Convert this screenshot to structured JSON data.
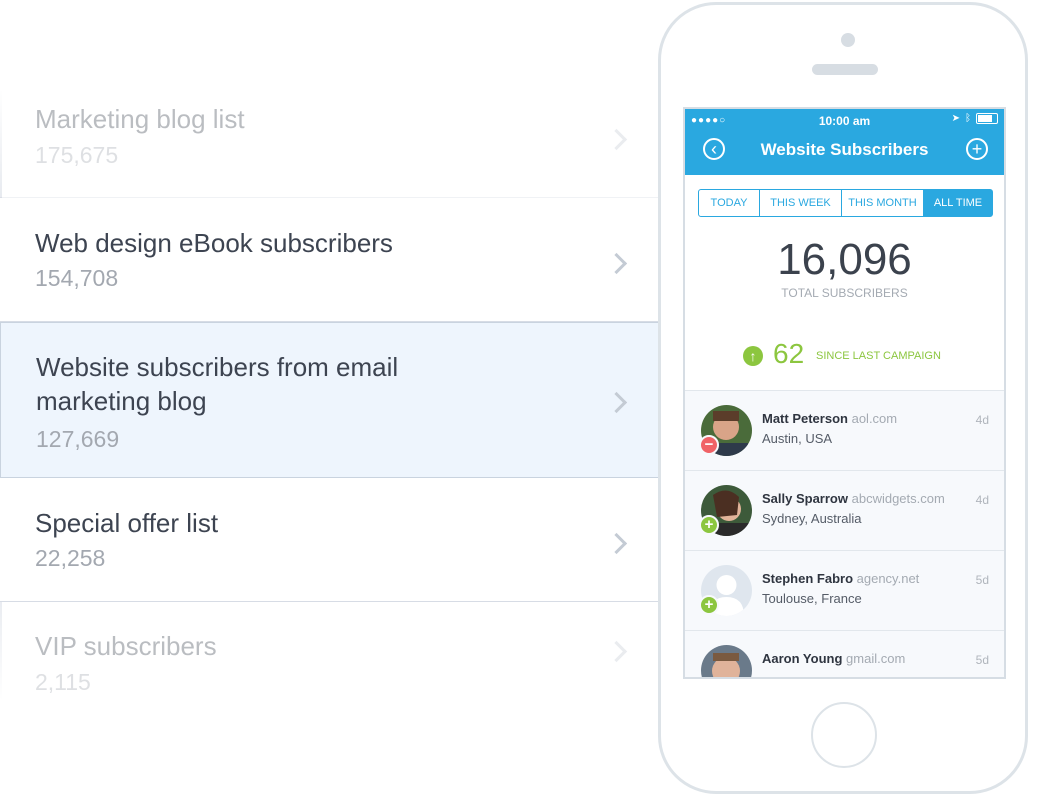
{
  "lists": [
    {
      "title": "Marketing blog list",
      "count": "175,675"
    },
    {
      "title": "Web design eBook subscribers",
      "count": "154,708"
    },
    {
      "title": "Website subscribers from email marketing blog",
      "count": "127,669"
    },
    {
      "title": "Special offer list",
      "count": "22,258"
    },
    {
      "title": "VIP subscribers",
      "count": "2,115"
    }
  ],
  "phone": {
    "status_bar": {
      "signal": "●●●●○",
      "time": "10:00 am"
    },
    "nav": {
      "title": "Website Subscribers",
      "back_icon": "chevron-left-circle-icon",
      "add_icon": "plus-circle-icon"
    },
    "segments": [
      "TODAY",
      "THIS WEEK",
      "THIS MONTH",
      "ALL TIME"
    ],
    "selected_segment": "ALL TIME",
    "total": {
      "value": "16,096",
      "label": "TOTAL SUBSCRIBERS"
    },
    "delta": {
      "value": "62",
      "label": "SINCE LAST CAMPAIGN"
    },
    "subscribers": [
      {
        "name": "Matt Peterson",
        "domain": "aol.com",
        "location": "Austin, USA",
        "age": "4d",
        "status": "remove"
      },
      {
        "name": "Sally Sparrow",
        "domain": "abcwidgets.com",
        "location": "Sydney, Australia",
        "age": "4d",
        "status": "add"
      },
      {
        "name": "Stephen Fabro",
        "domain": "agency.net",
        "location": "Toulouse, France",
        "age": "5d",
        "status": "add"
      },
      {
        "name": "Aaron Young",
        "domain": "gmail.com",
        "location": "",
        "age": "5d",
        "status": "none"
      }
    ]
  },
  "colors": {
    "accent": "#2aa8e0",
    "positive": "#8cc63f",
    "negative": "#f06266"
  }
}
